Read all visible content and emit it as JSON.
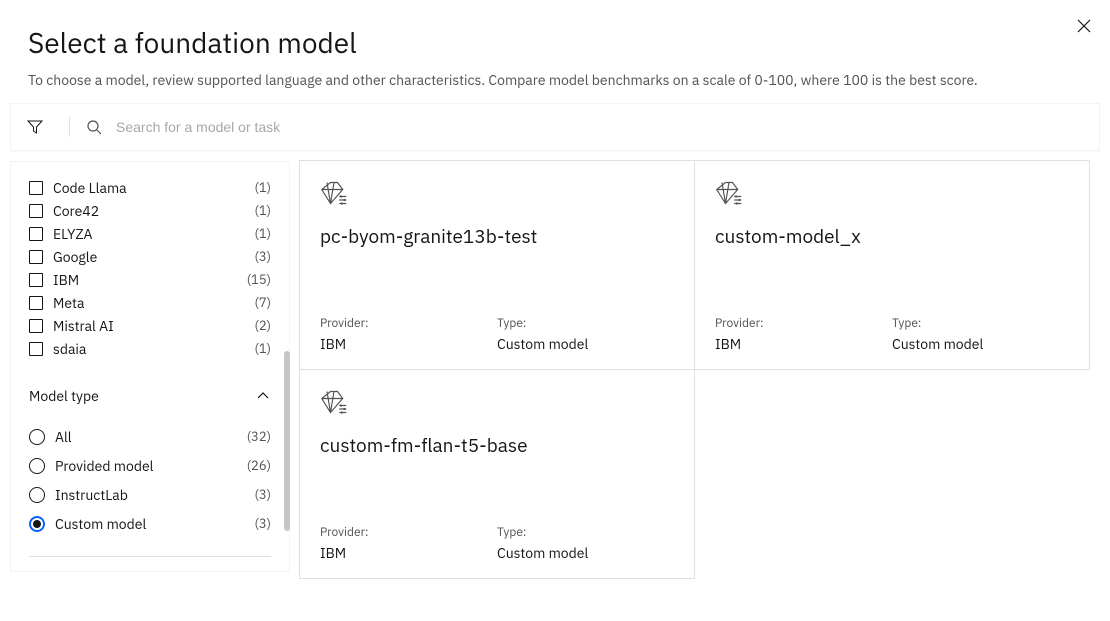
{
  "header": {
    "title": "Select a foundation model",
    "subtitle": "To choose a model, review supported language and other characteristics. Compare model benchmarks on a scale of 0-100, where 100 is the best score."
  },
  "search": {
    "placeholder": "Search for a model or task"
  },
  "sidebar": {
    "providers": [
      {
        "label": "Code Llama",
        "count": "(1)"
      },
      {
        "label": "Core42",
        "count": "(1)"
      },
      {
        "label": "ELYZA",
        "count": "(1)"
      },
      {
        "label": "Google",
        "count": "(3)"
      },
      {
        "label": "IBM",
        "count": "(15)"
      },
      {
        "label": "Meta",
        "count": "(7)"
      },
      {
        "label": "Mistral AI",
        "count": "(2)"
      },
      {
        "label": "sdaia",
        "count": "(1)"
      }
    ],
    "model_type_section_label": "Model type",
    "model_types": [
      {
        "label": "All",
        "count": "(32)",
        "selected": false
      },
      {
        "label": "Provided model",
        "count": "(26)",
        "selected": false
      },
      {
        "label": "InstructLab",
        "count": "(3)",
        "selected": false
      },
      {
        "label": "Custom model",
        "count": "(3)",
        "selected": true
      }
    ]
  },
  "meta_labels": {
    "provider": "Provider:",
    "type": "Type:"
  },
  "cards": [
    {
      "title": "pc-byom-granite13b-test",
      "provider": "IBM",
      "type": "Custom model"
    },
    {
      "title": "custom-model_x",
      "provider": "IBM",
      "type": "Custom model"
    },
    {
      "title": "custom-fm-flan-t5-base",
      "provider": "IBM",
      "type": "Custom model"
    }
  ]
}
